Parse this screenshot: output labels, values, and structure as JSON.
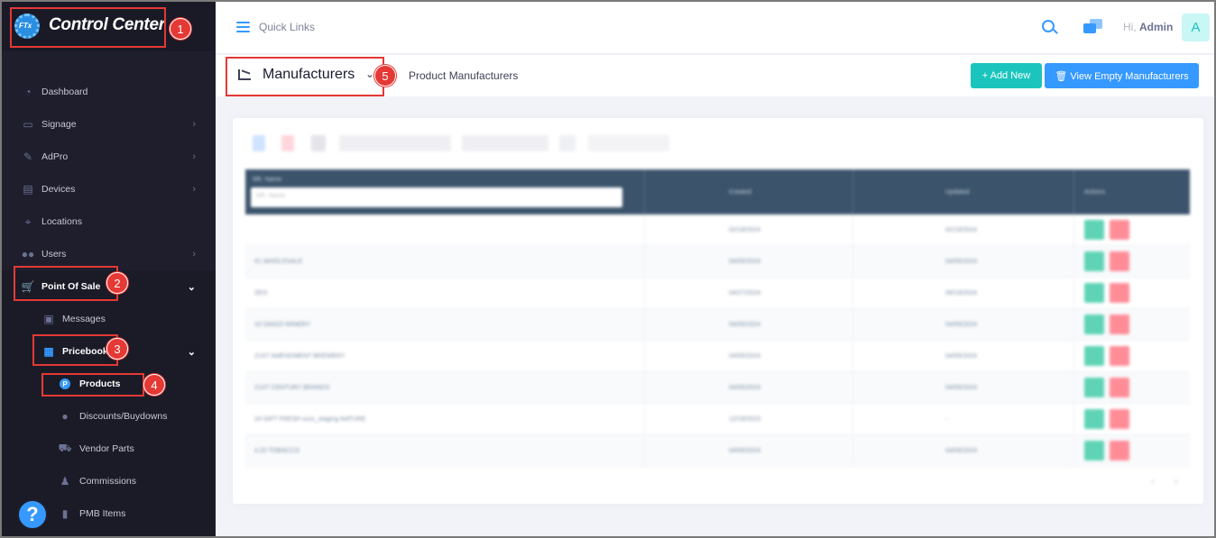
{
  "brand": {
    "logo_text": "FTx",
    "title": "Control Center"
  },
  "sidebar": {
    "items": [
      {
        "label": "Dashboard",
        "icon": "dashboard-icon",
        "chevron": ""
      },
      {
        "label": "Signage",
        "icon": "monitor-icon",
        "chevron": "›"
      },
      {
        "label": "AdPro",
        "icon": "brush-icon",
        "chevron": "›"
      },
      {
        "label": "Devices",
        "icon": "devices-icon",
        "chevron": "›"
      },
      {
        "label": "Locations",
        "icon": "location-icon",
        "chevron": ""
      },
      {
        "label": "Users",
        "icon": "users-icon",
        "chevron": "›"
      },
      {
        "label": "Point Of Sale",
        "icon": "cart-icon",
        "chevron": "⌄"
      }
    ],
    "pos_children": [
      {
        "label": "Messages",
        "icon": "inbox-icon",
        "chevron": ""
      },
      {
        "label": "Pricebook",
        "icon": "calculator-icon",
        "chevron": "⌄"
      }
    ],
    "pricebook_children": [
      {
        "label": "Products",
        "icon": "product-icon"
      },
      {
        "label": "Discounts/Buydowns",
        "icon": "discount-icon"
      },
      {
        "label": "Vendor Parts",
        "icon": "vendor-parts-icon"
      },
      {
        "label": "Commissions",
        "icon": "commission-icon"
      },
      {
        "label": "PMB Items",
        "icon": "pmb-icon"
      }
    ],
    "help": "?"
  },
  "topbar": {
    "quick_links": "Quick Links",
    "greeting_prefix": "Hi,",
    "user_name": "Admin",
    "avatar_letter": "A"
  },
  "subheader": {
    "title": "Manufacturers",
    "subtitle": "Product Manufacturers",
    "add_new": "+ Add New",
    "view_empty": "🗑 View Empty Manufacturers"
  },
  "table": {
    "columns": [
      "Mfr. Name",
      "Created",
      "Updated",
      "Actions"
    ],
    "filter_placeholder": "Mfr. Name",
    "rows": [
      {
        "name": "",
        "created": "02/19/2024",
        "updated": "02/19/2024"
      },
      {
        "name": "#1 WHOLESALE",
        "created": "04/05/2024",
        "updated": "04/05/2024"
      },
      {
        "name": "ZEO",
        "created": "04/27/2024",
        "updated": "09/19/2024"
      },
      {
        "name": "10 DAIGO WINERY",
        "created": "04/05/2024",
        "updated": "04/05/2024"
      },
      {
        "name": "21ST AMENDMENT BREWERY",
        "created": "04/05/2024",
        "updated": "04/05/2024"
      },
      {
        "name": "21ST CENTURY BRANDS",
        "created": "04/05/2024",
        "updated": "04/05/2024"
      },
      {
        "name": "24 GIFT FRESH ours_staging NATURE",
        "created": "12/19/2023",
        "updated": "-"
      },
      {
        "name": "4:20 TOBACCO",
        "created": "04/05/2024",
        "updated": "04/05/2024"
      }
    ]
  },
  "annotations": [
    "1",
    "2",
    "3",
    "4",
    "5"
  ],
  "colors": {
    "sidebar_bg": "#1e1e2d",
    "accent_blue": "#3699ff",
    "accent_teal": "#1bc5bd",
    "table_header": "#3b536b",
    "annotation_red": "#e53935"
  }
}
